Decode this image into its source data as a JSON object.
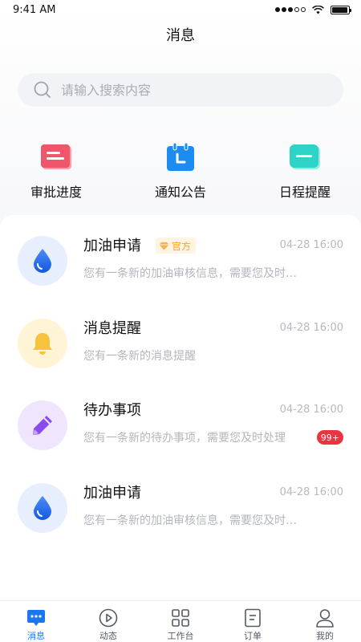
{
  "status_bar": {
    "time": "9:41 AM",
    "battery_level": 0.95
  },
  "header": {
    "title": "消息"
  },
  "search": {
    "placeholder": "请输入搜索内容",
    "value": ""
  },
  "quick_actions": [
    {
      "label": "审批进度",
      "icon": "approval-icon",
      "color": "#f0566a"
    },
    {
      "label": "通知公告",
      "icon": "calendar-icon",
      "color": "#1d8cf0"
    },
    {
      "label": "日程提醒",
      "icon": "reminder-icon",
      "color": "#2fd2c6"
    }
  ],
  "messages": [
    {
      "title": "加油申请",
      "badge": "官方",
      "time": "04-28 16:00",
      "preview": "您有一条新的加油审核信息，需要您及时处理",
      "icon": "drop-icon"
    },
    {
      "title": "消息提醒",
      "badge": "",
      "time": "04-28 16:00",
      "preview": "您有一条新的消息提醒",
      "icon": "bell-icon"
    },
    {
      "title": "待办事项",
      "badge": "",
      "time": "04-28 16:00",
      "preview": "您有一条新的待办事项，需要您及时处理",
      "icon": "pen-icon",
      "unread": "99+"
    },
    {
      "title": "加油申请",
      "badge": "",
      "time": "04-28 16:00",
      "preview": "您有一条新的加油审核信息，需要您及时处理",
      "icon": "drop-icon"
    }
  ],
  "tabbar": [
    {
      "label": "消息",
      "icon": "message-icon",
      "active": true
    },
    {
      "label": "动态",
      "icon": "play-icon",
      "active": false
    },
    {
      "label": "工作台",
      "icon": "grid-icon",
      "active": false
    },
    {
      "label": "订单",
      "icon": "order-icon",
      "active": false
    },
    {
      "label": "我的",
      "icon": "user-icon",
      "active": false
    }
  ],
  "colors": {
    "accent": "#1978f0",
    "unread_badge": "#e8353f",
    "official_badge_text": "#f2a33a"
  }
}
